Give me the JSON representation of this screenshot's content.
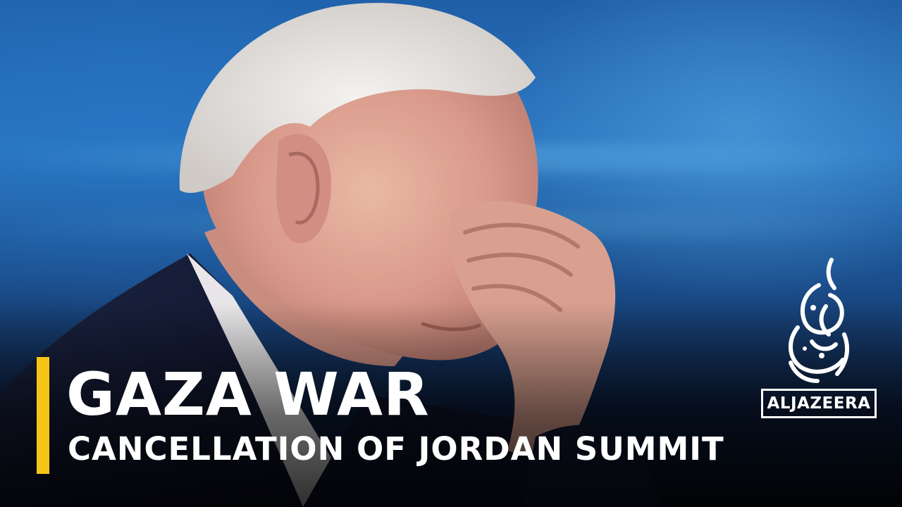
{
  "headline": "GAZA WAR",
  "subheadline": "CANCELLATION OF JORDAN SUMMIT",
  "logo": {
    "text": "ALJAZEERA",
    "icon": "al-jazeera-calligraphy-emblem"
  },
  "colors": {
    "accent": "#f5c518",
    "text": "#ffffff",
    "background": "#1f5fa8"
  }
}
